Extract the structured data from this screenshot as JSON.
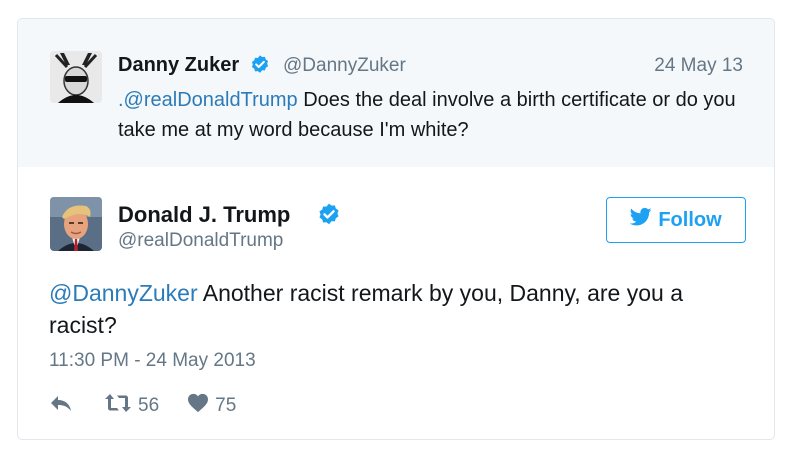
{
  "parent_tweet": {
    "author_name": "Danny Zuker",
    "handle": "@DannyZuker",
    "date": "24 May 13",
    "mention": ".@realDonaldTrump",
    "text": " Does the deal involve a birth certificate or do you take me at my word because I'm white?"
  },
  "main_tweet": {
    "author_name": "Donald J. Trump",
    "handle": "@realDonaldTrump",
    "follow_label": "Follow",
    "mention": "@DannyZuker",
    "text": " Another racist remark by you, Danny, are you a racist?",
    "timestamp": "11:30 PM - 24 May 2013",
    "retweet_count": "56",
    "like_count": "75"
  },
  "colors": {
    "link": "#2b7bb9",
    "verified": "#1da1f2",
    "secondary_text": "#657786",
    "parent_background": "#f5f8fa"
  },
  "icons": [
    "verified-badge-icon",
    "twitter-bird-icon",
    "reply-icon",
    "retweet-icon",
    "heart-icon"
  ]
}
